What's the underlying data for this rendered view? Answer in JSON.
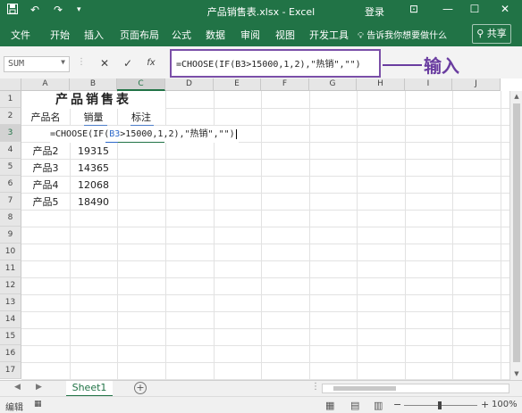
{
  "titlebar": {
    "save_icon": "save-icon",
    "undo_glyph": "↶",
    "redo_glyph": "↷",
    "customize_glyph": "▾",
    "title": "产品销售表.xlsx  -  Excel",
    "login": "登录",
    "ribbon_display_glyph": "⊡",
    "minimize_glyph": "—",
    "maximize_glyph": "☐",
    "close_glyph": "✕"
  },
  "ribbon": {
    "tabs": [
      "文件",
      "开始",
      "插入",
      "页面布局",
      "公式",
      "数据",
      "审阅",
      "视图",
      "开发工具"
    ],
    "tell_me": "告诉我你想要做什么",
    "share": "共享"
  },
  "formula_bar": {
    "name_box": "SUM",
    "cancel_glyph": "✕",
    "enter_glyph": "✓",
    "fx_glyph": "fx",
    "formula": "=CHOOSE(IF(B3>15000,1,2),\"热销\",\"\")",
    "annotation": "输入"
  },
  "grid": {
    "columns": [
      "A",
      "B",
      "C",
      "D",
      "E",
      "F",
      "G",
      "H",
      "I",
      "J"
    ],
    "rows": [
      "1",
      "2",
      "3",
      "4",
      "5",
      "6",
      "7",
      "8",
      "9",
      "10",
      "11",
      "12",
      "13",
      "14",
      "15",
      "16",
      "17"
    ],
    "table_title": "产品销售表",
    "headers": [
      "产品名",
      "销量",
      "标注"
    ],
    "edit_formula": {
      "before": "=CHOOSE(IF(",
      "ref": "B3",
      "after": ">15000,1,2),\"热销\",\"\")"
    },
    "data_rows": [
      {
        "name": "产品2",
        "sales": "19315"
      },
      {
        "name": "产品3",
        "sales": "14365"
      },
      {
        "name": "产品4",
        "sales": "12068"
      },
      {
        "name": "产品5",
        "sales": "18490"
      }
    ]
  },
  "sheets": {
    "active_tab": "Sheet1",
    "add_glyph": "+"
  },
  "statusbar": {
    "mode": "编辑",
    "zoom": "100%"
  },
  "colors": {
    "excel_green": "#217346",
    "annotation_purple": "#6a3da0",
    "cell_reference_blue": "#2c68c9"
  }
}
